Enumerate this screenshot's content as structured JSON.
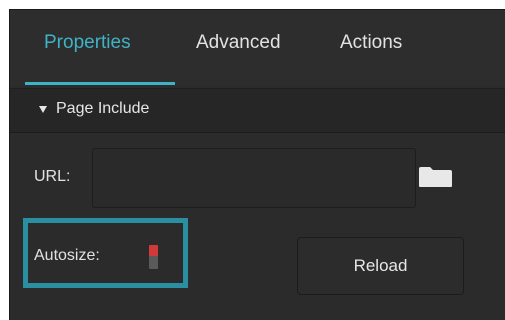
{
  "tabs": [
    {
      "label": "Properties",
      "active": true
    },
    {
      "label": "Advanced",
      "active": false
    },
    {
      "label": "Actions",
      "active": false
    }
  ],
  "section": {
    "title": "Page Include",
    "expanded": true,
    "icon": "triangle-down-icon"
  },
  "url": {
    "label": "URL:",
    "value": "",
    "placeholder": "",
    "browse_icon": "folder-icon"
  },
  "autosize": {
    "label": "Autosize:",
    "toggle_state": "on"
  },
  "reload": {
    "label": "Reload"
  },
  "colors": {
    "accent": "#3fb3c6",
    "panel_background": "#2b2b2b",
    "highlight_border": "#2a8fa1",
    "toggle_on": "#d23a3a"
  }
}
